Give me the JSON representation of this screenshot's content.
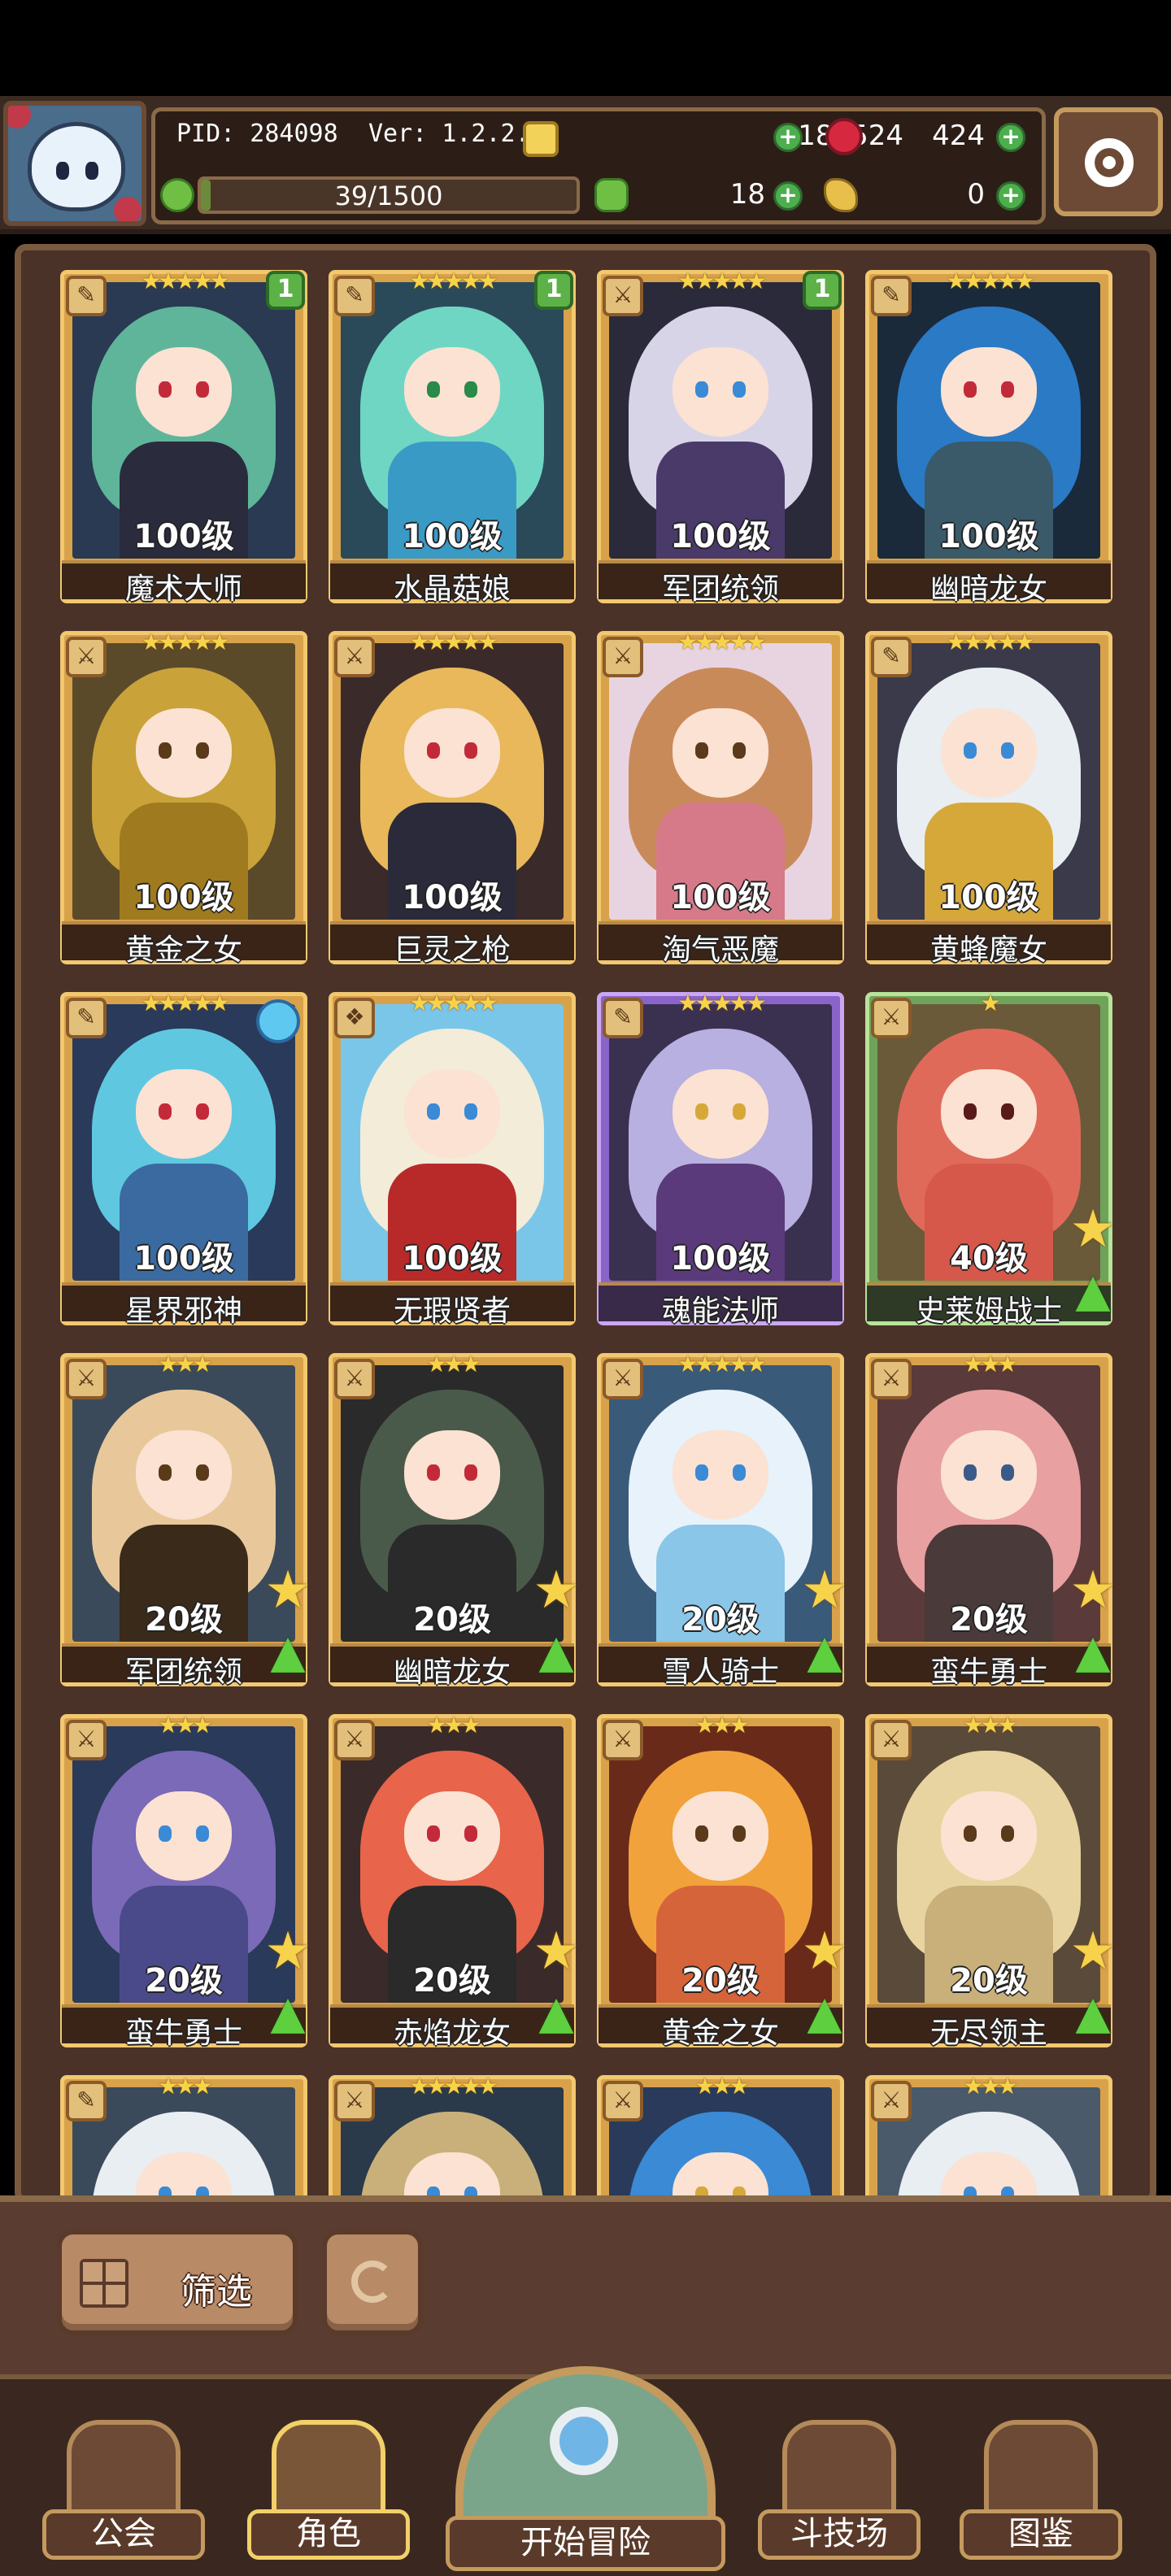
{
  "header": {
    "pid": "PID: 284098",
    "version": "Ver: 1.2.2.5",
    "gold": "8180524",
    "gems": "424",
    "exp_text": "39/1500",
    "exp_fraction": 0.026,
    "clover": "18",
    "keys": "0"
  },
  "cards": [
    {
      "name": "魔术大师",
      "level": "100级",
      "stars": "★★★★★",
      "badge": "1",
      "frame": "gold",
      "class": "wand",
      "hair": "#5fb59a",
      "outfit": "#2b2b3e",
      "bg": "#2a3a52",
      "eye": "#c22a3a"
    },
    {
      "name": "水晶菇娘",
      "level": "100级",
      "stars": "★★★★★",
      "badge": "1",
      "frame": "gold",
      "class": "wand",
      "hair": "#6fd6c4",
      "outfit": "#3a9ac6",
      "bg": "#2a4a5a",
      "eye": "#2a8a4a"
    },
    {
      "name": "军团统领",
      "level": "100级",
      "stars": "★★★★★",
      "badge": "1",
      "frame": "gold",
      "class": "sword",
      "hair": "#d8d4e8",
      "outfit": "#4a3a6a",
      "bg": "#2a2a3a",
      "eye": "#3a8ad6"
    },
    {
      "name": "幽暗龙女",
      "level": "100级",
      "stars": "★★★★★",
      "badge": "",
      "frame": "gold",
      "class": "wand",
      "hair": "#2a7ac6",
      "outfit": "#3a5a6a",
      "bg": "#1a2a3a",
      "eye": "#c22a3a"
    },
    {
      "name": "黄金之女",
      "level": "100级",
      "stars": "★★★★★",
      "badge": "",
      "frame": "gold",
      "class": "sword",
      "hair": "#c9a23a",
      "outfit": "#a07a1e",
      "bg": "#5a4a2a",
      "eye": "#5a3a1a"
    },
    {
      "name": "巨灵之枪",
      "level": "100级",
      "stars": "★★★★★",
      "badge": "",
      "frame": "gold",
      "class": "sword",
      "hair": "#e8b85a",
      "outfit": "#2a2a3a",
      "bg": "#3a2a2a",
      "eye": "#c22a3a"
    },
    {
      "name": "淘气恶魔",
      "level": "100级",
      "stars": "★★★★★",
      "badge": "",
      "frame": "gold",
      "class": "sword",
      "hair": "#c98a5a",
      "outfit": "#d67a8a",
      "bg": "#e8d4e0",
      "eye": "#5a3a1a"
    },
    {
      "name": "黄蜂魔女",
      "level": "100级",
      "stars": "★★★★★",
      "badge": "",
      "frame": "gold",
      "class": "wand",
      "hair": "#e8eef2",
      "outfit": "#d6a83a",
      "bg": "#3a3a4a",
      "eye": "#3a8ad6"
    },
    {
      "name": "星界邪神",
      "level": "100级",
      "stars": "★★★★★",
      "badge": "",
      "frame": "gold",
      "class": "wand",
      "hair": "#5fc8e0",
      "outfit": "#3a6aa0",
      "bg": "#2a3a5a",
      "eye": "#c22a3a",
      "orb": true
    },
    {
      "name": "无瑕贤者",
      "level": "100级",
      "stars": "★★★★★",
      "badge": "",
      "frame": "gold",
      "class": "shield",
      "hair": "#f2ecd8",
      "outfit": "#b82a2a",
      "bg": "#7ac6e8",
      "eye": "#3a8ad6"
    },
    {
      "name": "魂能法师",
      "level": "100级",
      "stars": "★★★★★",
      "badge": "",
      "frame": "purple",
      "class": "wand",
      "hair": "#b8b0e0",
      "outfit": "#5a3a7a",
      "bg": "#3a3050",
      "eye": "#d6a83a"
    },
    {
      "name": "史莱姆战士",
      "level": "40级",
      "stars": "★",
      "badge": "",
      "frame": "green",
      "class": "sword",
      "hair": "#e06a5a",
      "outfit": "#d6584a",
      "bg": "#6a5a3a",
      "eye": "#5a1a1a",
      "upgrade": true
    },
    {
      "name": "军团统领",
      "level": "20级",
      "stars": "★★★",
      "badge": "",
      "frame": "gold",
      "class": "sword",
      "hair": "#e8c89a",
      "outfit": "#3a2a1a",
      "bg": "#3a4a5a",
      "eye": "#5a3a1a",
      "upgrade": true
    },
    {
      "name": "幽暗龙女",
      "level": "20级",
      "stars": "★★★",
      "badge": "",
      "frame": "gold",
      "class": "sword",
      "hair": "#4a5a4a",
      "outfit": "#2a2a2a",
      "bg": "#2a2a2a",
      "eye": "#c22a3a",
      "upgrade": true
    },
    {
      "name": "雪人骑士",
      "level": "20级",
      "stars": "★★★★★",
      "badge": "",
      "frame": "gold",
      "class": "sword",
      "hair": "#e8f2fb",
      "outfit": "#8ac6e8",
      "bg": "#3a5a7a",
      "eye": "#3a8ad6",
      "upgrade": true
    },
    {
      "name": "蛮牛勇士",
      "level": "20级",
      "stars": "★★★",
      "badge": "",
      "frame": "gold",
      "class": "sword",
      "hair": "#e8a0a0",
      "outfit": "#4a3a3a",
      "bg": "#5a3a3a",
      "eye": "#3a5a8a",
      "upgrade": true
    },
    {
      "name": "蛮牛勇士",
      "level": "20级",
      "stars": "★★★",
      "badge": "",
      "frame": "gold",
      "class": "sword",
      "hair": "#7a6ab8",
      "outfit": "#4a4a8a",
      "bg": "#2a3a5a",
      "eye": "#3a8ad6",
      "upgrade": true
    },
    {
      "name": "赤焰龙女",
      "level": "20级",
      "stars": "★★★",
      "badge": "",
      "frame": "gold",
      "class": "sword",
      "hair": "#e8644a",
      "outfit": "#2a2a2a",
      "bg": "#3a2a2a",
      "eye": "#c22a3a",
      "upgrade": true
    },
    {
      "name": "黄金之女",
      "level": "20级",
      "stars": "★★★",
      "badge": "",
      "frame": "gold",
      "class": "sword",
      "hair": "#f2a23a",
      "outfit": "#d6643a",
      "bg": "#6a2a1a",
      "eye": "#5a3a1a",
      "upgrade": true
    },
    {
      "name": "无尽领主",
      "level": "20级",
      "stars": "★★★",
      "badge": "",
      "frame": "gold",
      "class": "sword",
      "hair": "#e8d4a0",
      "outfit": "#c9b07a",
      "bg": "#5a4a3a",
      "eye": "#5a3a1a",
      "upgrade": true
    },
    {
      "name": "",
      "level": "",
      "stars": "★★★",
      "badge": "",
      "frame": "gold",
      "class": "wand",
      "hair": "#e8eef2",
      "outfit": "#8a8aa0",
      "bg": "#3a4a5a",
      "eye": "#3a8ad6"
    },
    {
      "name": "",
      "level": "",
      "stars": "★★★★★",
      "badge": "",
      "frame": "gold",
      "class": "sword",
      "hair": "#c9b07a",
      "outfit": "#3a6a8a",
      "bg": "#2a3a4a",
      "eye": "#3a8ad6"
    },
    {
      "name": "",
      "level": "",
      "stars": "★★★",
      "badge": "",
      "frame": "gold",
      "class": "sword",
      "hair": "#3a8ad6",
      "outfit": "#2a5a8a",
      "bg": "#2a3a5a",
      "eye": "#d6a83a"
    },
    {
      "name": "",
      "level": "",
      "stars": "★★★",
      "badge": "",
      "frame": "gold",
      "class": "sword",
      "hair": "#e8eef2",
      "outfit": "#8a9ab0",
      "bg": "#4a5a6a",
      "eye": "#3a8ad6"
    }
  ],
  "filter": {
    "label": "筛选"
  },
  "nav": {
    "guild": "公会",
    "character": "角色",
    "adventure": "开始冒险",
    "arena": "斗技场",
    "codex": "图鉴"
  },
  "colors": {
    "frame_gold": "#d8a24a",
    "frame_purple": "#8a64c8",
    "frame_green": "#6fa35a",
    "panel": "#4a3228"
  }
}
